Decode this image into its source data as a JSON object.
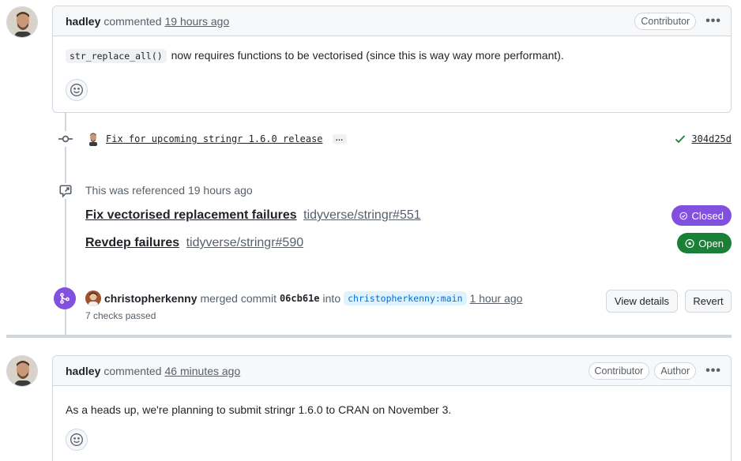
{
  "comment1": {
    "author": "hadley",
    "verb": "commented",
    "time": "19 hours ago",
    "badges": [
      "Contributor"
    ],
    "more": "•••",
    "code": "str_replace_all()",
    "text": "now requires functions to be vectorised (since this is way way more performant)."
  },
  "commit": {
    "message": "Fix for upcoming stringr 1.6.0 release",
    "ellipsis": "…",
    "sha": "304d25d",
    "status_color": "#1a7f37"
  },
  "reference": {
    "label": "This was referenced 19 hours ago",
    "items": [
      {
        "title": "Fix vectorised replacement failures",
        "repo": "tidyverse/stringr#551",
        "state": "Closed",
        "color": "#8250df"
      },
      {
        "title": "Revdep failures",
        "repo": "tidyverse/stringr#590",
        "state": "Open",
        "color": "#1a7f37"
      }
    ]
  },
  "merge": {
    "user": "christopherkenny",
    "verb": "merged commit",
    "sha": "06cb61e",
    "into": "into",
    "branch": "christopherkenny:main",
    "time": "1 hour ago",
    "checks": "7 checks passed",
    "view_details": "View details",
    "revert": "Revert",
    "icon_color": "#8250df"
  },
  "comment2": {
    "author": "hadley",
    "verb": "commented",
    "time": "46 minutes ago",
    "badges": [
      "Contributor",
      "Author"
    ],
    "more": "•••",
    "text": "As a heads up, we're planning to submit stringr 1.6.0 to CRAN on November 3."
  }
}
